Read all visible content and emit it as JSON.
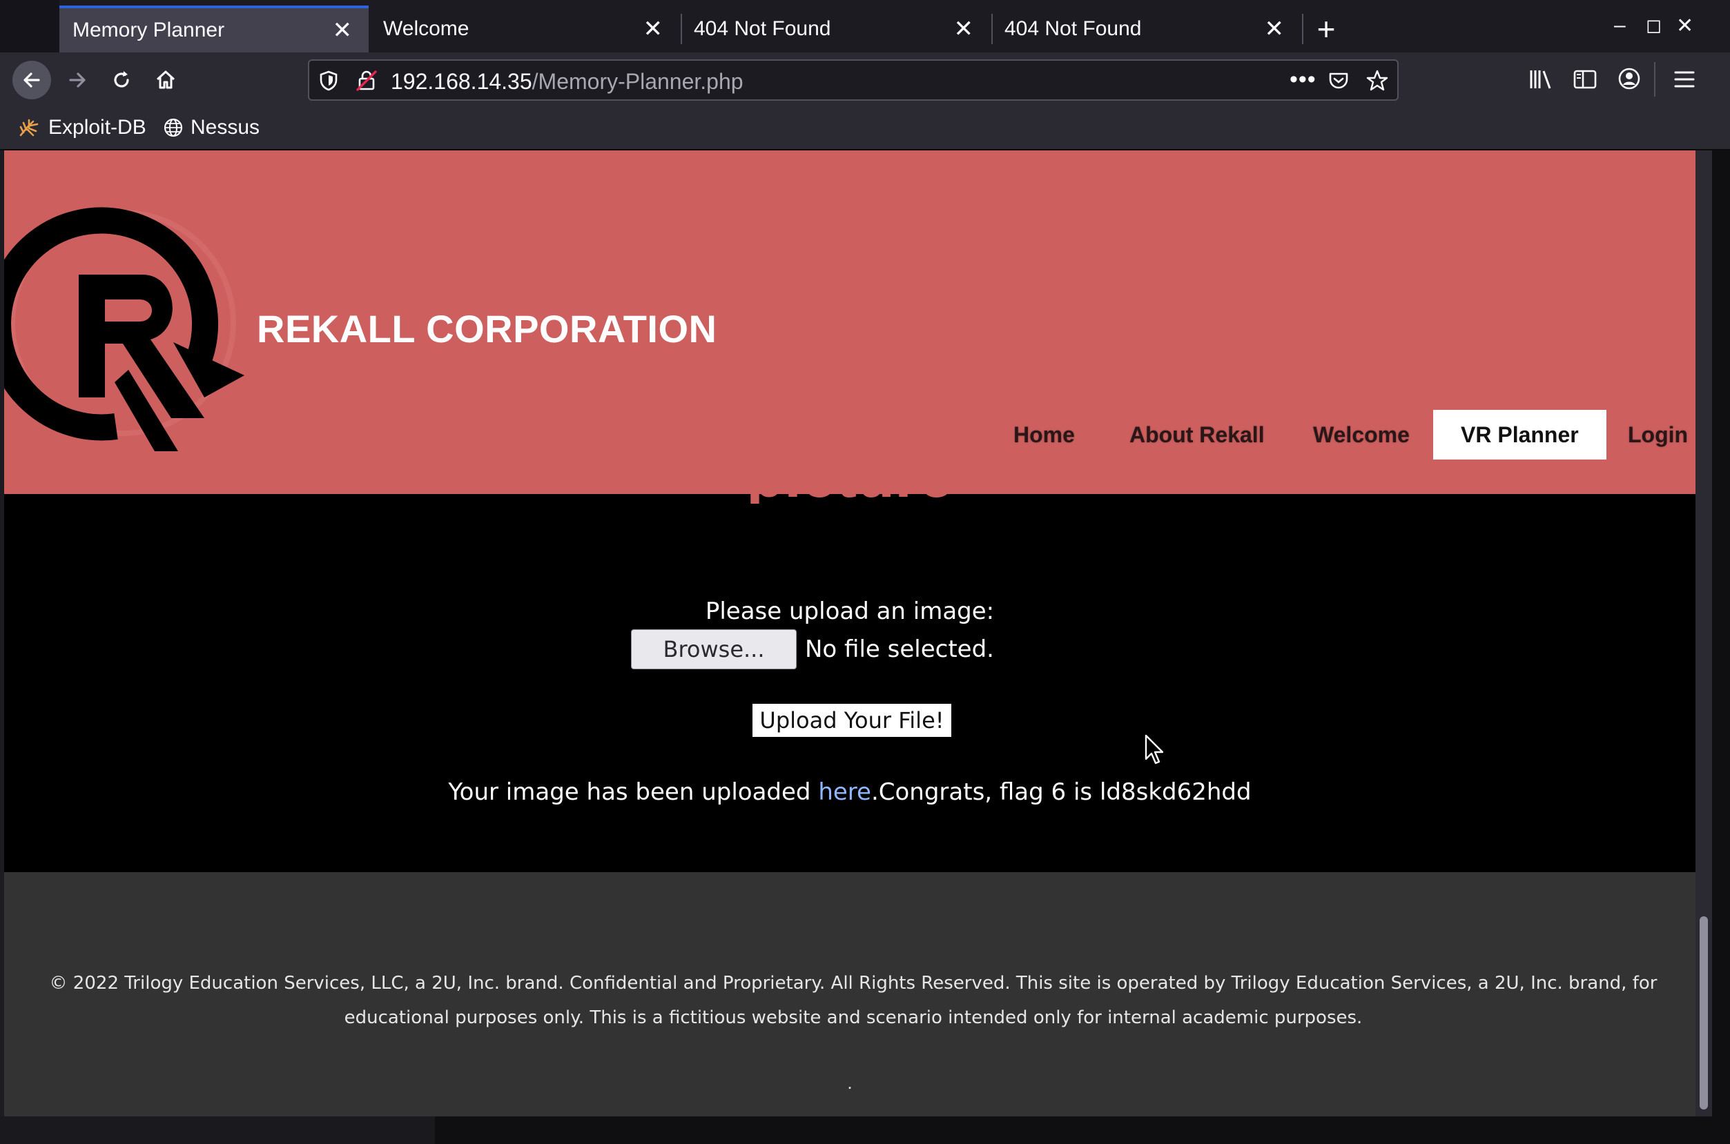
{
  "tabs": [
    {
      "title": "Memory Planner",
      "active": true
    },
    {
      "title": "Welcome",
      "active": false
    },
    {
      "title": "404 Not Found",
      "active": false
    },
    {
      "title": "404 Not Found",
      "active": false
    }
  ],
  "window_controls": {
    "minimize": "–",
    "maximize": "◻",
    "close": "✕"
  },
  "toolbar": {
    "url_host": "192.168.14.35",
    "url_path": "/Memory-Planner.php"
  },
  "bookmarks": [
    {
      "label": "Exploit-DB",
      "icon": "spider-icon"
    },
    {
      "label": "Nessus",
      "icon": "globe-icon"
    }
  ],
  "site": {
    "brand": "REKALL CORPORATION",
    "nav": [
      {
        "label": "Home",
        "active": false
      },
      {
        "label": "About Rekall",
        "active": false
      },
      {
        "label": "Welcome",
        "active": false
      },
      {
        "label": "VR Planner",
        "active": true
      },
      {
        "label": "Login",
        "active": false
      }
    ],
    "partial_heading": "picture",
    "upload_label": "Please upload an image:",
    "browse_label": "Browse...",
    "no_file_text": "No file selected.",
    "upload_button": "Upload Your File!",
    "result_prefix": "Your image has been uploaded ",
    "result_link": "here",
    "result_suffix": ".Congrats, flag 6 is ld8skd62hdd",
    "footer_text": "© 2022 Trilogy Education Services, LLC, a 2U, Inc. brand. Confidential and Proprietary. All Rights Reserved. This site is operated by Trilogy Education Services, a 2U, Inc. brand, for educational purposes only. This is a fictitious website and scenario intended only for internal academic purposes.",
    "footer_dot": "."
  },
  "colors": {
    "header_bg": "#cd5f5f",
    "main_bg": "#000000",
    "footer_bg": "#333333",
    "tab_accent": "#2f63dd"
  }
}
